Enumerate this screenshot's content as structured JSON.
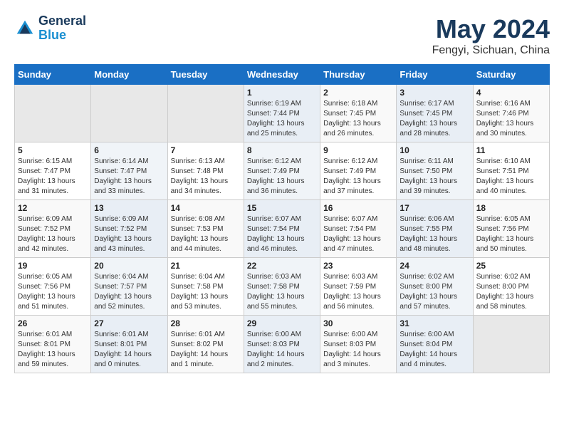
{
  "header": {
    "logo_line1": "General",
    "logo_line2": "Blue",
    "month_year": "May 2024",
    "location": "Fengyi, Sichuan, China"
  },
  "days_of_week": [
    "Sunday",
    "Monday",
    "Tuesday",
    "Wednesday",
    "Thursday",
    "Friday",
    "Saturday"
  ],
  "weeks": [
    [
      {
        "day": "",
        "sunrise": "",
        "sunset": "",
        "daylight": "",
        "empty": true
      },
      {
        "day": "",
        "sunrise": "",
        "sunset": "",
        "daylight": "",
        "empty": true
      },
      {
        "day": "",
        "sunrise": "",
        "sunset": "",
        "daylight": "",
        "empty": true
      },
      {
        "day": "1",
        "sunrise": "Sunrise: 6:19 AM",
        "sunset": "Sunset: 7:44 PM",
        "daylight": "Daylight: 13 hours and 25 minutes."
      },
      {
        "day": "2",
        "sunrise": "Sunrise: 6:18 AM",
        "sunset": "Sunset: 7:45 PM",
        "daylight": "Daylight: 13 hours and 26 minutes."
      },
      {
        "day": "3",
        "sunrise": "Sunrise: 6:17 AM",
        "sunset": "Sunset: 7:45 PM",
        "daylight": "Daylight: 13 hours and 28 minutes."
      },
      {
        "day": "4",
        "sunrise": "Sunrise: 6:16 AM",
        "sunset": "Sunset: 7:46 PM",
        "daylight": "Daylight: 13 hours and 30 minutes."
      }
    ],
    [
      {
        "day": "5",
        "sunrise": "Sunrise: 6:15 AM",
        "sunset": "Sunset: 7:47 PM",
        "daylight": "Daylight: 13 hours and 31 minutes."
      },
      {
        "day": "6",
        "sunrise": "Sunrise: 6:14 AM",
        "sunset": "Sunset: 7:47 PM",
        "daylight": "Daylight: 13 hours and 33 minutes."
      },
      {
        "day": "7",
        "sunrise": "Sunrise: 6:13 AM",
        "sunset": "Sunset: 7:48 PM",
        "daylight": "Daylight: 13 hours and 34 minutes."
      },
      {
        "day": "8",
        "sunrise": "Sunrise: 6:12 AM",
        "sunset": "Sunset: 7:49 PM",
        "daylight": "Daylight: 13 hours and 36 minutes."
      },
      {
        "day": "9",
        "sunrise": "Sunrise: 6:12 AM",
        "sunset": "Sunset: 7:49 PM",
        "daylight": "Daylight: 13 hours and 37 minutes."
      },
      {
        "day": "10",
        "sunrise": "Sunrise: 6:11 AM",
        "sunset": "Sunset: 7:50 PM",
        "daylight": "Daylight: 13 hours and 39 minutes."
      },
      {
        "day": "11",
        "sunrise": "Sunrise: 6:10 AM",
        "sunset": "Sunset: 7:51 PM",
        "daylight": "Daylight: 13 hours and 40 minutes."
      }
    ],
    [
      {
        "day": "12",
        "sunrise": "Sunrise: 6:09 AM",
        "sunset": "Sunset: 7:52 PM",
        "daylight": "Daylight: 13 hours and 42 minutes."
      },
      {
        "day": "13",
        "sunrise": "Sunrise: 6:09 AM",
        "sunset": "Sunset: 7:52 PM",
        "daylight": "Daylight: 13 hours and 43 minutes."
      },
      {
        "day": "14",
        "sunrise": "Sunrise: 6:08 AM",
        "sunset": "Sunset: 7:53 PM",
        "daylight": "Daylight: 13 hours and 44 minutes."
      },
      {
        "day": "15",
        "sunrise": "Sunrise: 6:07 AM",
        "sunset": "Sunset: 7:54 PM",
        "daylight": "Daylight: 13 hours and 46 minutes."
      },
      {
        "day": "16",
        "sunrise": "Sunrise: 6:07 AM",
        "sunset": "Sunset: 7:54 PM",
        "daylight": "Daylight: 13 hours and 47 minutes."
      },
      {
        "day": "17",
        "sunrise": "Sunrise: 6:06 AM",
        "sunset": "Sunset: 7:55 PM",
        "daylight": "Daylight: 13 hours and 48 minutes."
      },
      {
        "day": "18",
        "sunrise": "Sunrise: 6:05 AM",
        "sunset": "Sunset: 7:56 PM",
        "daylight": "Daylight: 13 hours and 50 minutes."
      }
    ],
    [
      {
        "day": "19",
        "sunrise": "Sunrise: 6:05 AM",
        "sunset": "Sunset: 7:56 PM",
        "daylight": "Daylight: 13 hours and 51 minutes."
      },
      {
        "day": "20",
        "sunrise": "Sunrise: 6:04 AM",
        "sunset": "Sunset: 7:57 PM",
        "daylight": "Daylight: 13 hours and 52 minutes."
      },
      {
        "day": "21",
        "sunrise": "Sunrise: 6:04 AM",
        "sunset": "Sunset: 7:58 PM",
        "daylight": "Daylight: 13 hours and 53 minutes."
      },
      {
        "day": "22",
        "sunrise": "Sunrise: 6:03 AM",
        "sunset": "Sunset: 7:58 PM",
        "daylight": "Daylight: 13 hours and 55 minutes."
      },
      {
        "day": "23",
        "sunrise": "Sunrise: 6:03 AM",
        "sunset": "Sunset: 7:59 PM",
        "daylight": "Daylight: 13 hours and 56 minutes."
      },
      {
        "day": "24",
        "sunrise": "Sunrise: 6:02 AM",
        "sunset": "Sunset: 8:00 PM",
        "daylight": "Daylight: 13 hours and 57 minutes."
      },
      {
        "day": "25",
        "sunrise": "Sunrise: 6:02 AM",
        "sunset": "Sunset: 8:00 PM",
        "daylight": "Daylight: 13 hours and 58 minutes."
      }
    ],
    [
      {
        "day": "26",
        "sunrise": "Sunrise: 6:01 AM",
        "sunset": "Sunset: 8:01 PM",
        "daylight": "Daylight: 13 hours and 59 minutes."
      },
      {
        "day": "27",
        "sunrise": "Sunrise: 6:01 AM",
        "sunset": "Sunset: 8:01 PM",
        "daylight": "Daylight: 14 hours and 0 minutes."
      },
      {
        "day": "28",
        "sunrise": "Sunrise: 6:01 AM",
        "sunset": "Sunset: 8:02 PM",
        "daylight": "Daylight: 14 hours and 1 minute."
      },
      {
        "day": "29",
        "sunrise": "Sunrise: 6:00 AM",
        "sunset": "Sunset: 8:03 PM",
        "daylight": "Daylight: 14 hours and 2 minutes."
      },
      {
        "day": "30",
        "sunrise": "Sunrise: 6:00 AM",
        "sunset": "Sunset: 8:03 PM",
        "daylight": "Daylight: 14 hours and 3 minutes."
      },
      {
        "day": "31",
        "sunrise": "Sunrise: 6:00 AM",
        "sunset": "Sunset: 8:04 PM",
        "daylight": "Daylight: 14 hours and 4 minutes."
      },
      {
        "day": "",
        "sunrise": "",
        "sunset": "",
        "daylight": "",
        "empty": true
      }
    ]
  ]
}
